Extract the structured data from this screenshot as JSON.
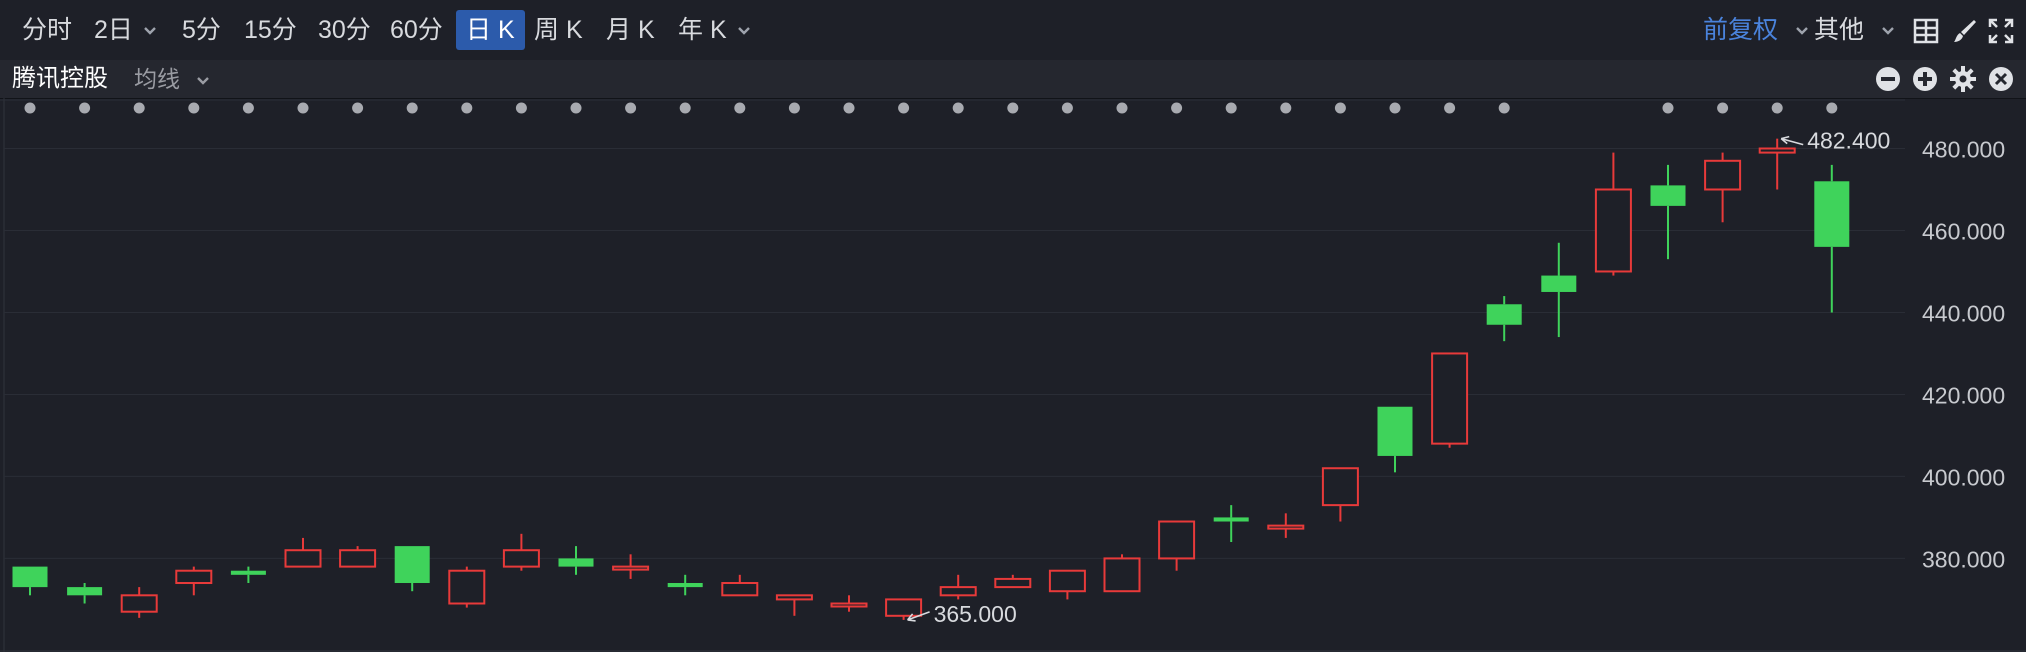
{
  "toolbar": {
    "tabs": [
      {
        "label": "分时"
      },
      {
        "label": "2日"
      },
      {
        "label": "5分"
      },
      {
        "label": "15分"
      },
      {
        "label": "30分"
      },
      {
        "label": "60分"
      },
      {
        "label": "日 K"
      },
      {
        "label": "周 K"
      },
      {
        "label": "月 K"
      },
      {
        "label": "年 K"
      }
    ],
    "active_tab": "日 K",
    "adjust_label": "前复权",
    "other_label": "其他"
  },
  "subbar": {
    "stock_name": "腾讯控股",
    "indicator_label": "均线"
  },
  "colors": {
    "up": "#e83a3a",
    "down": "#3fd35b",
    "accent": "#2c5bab",
    "background": "#1e2028"
  },
  "icons": [
    "grid-layout-icon",
    "brush-icon",
    "fullscreen-icon",
    "minus-icon",
    "plus-icon",
    "gear-icon",
    "close-icon",
    "chevron-down-icon"
  ],
  "chart_data": {
    "type": "candlestick",
    "ylim": [
      364,
      485
    ],
    "yticks": [
      "380.000",
      "400.000",
      "420.000",
      "440.000",
      "460.000",
      "480.000"
    ],
    "grid": true,
    "axis_position": "right",
    "series": [
      {
        "open": 378.0,
        "close": 373.0,
        "high": 378.0,
        "low": 371.0
      },
      {
        "open": 373.0,
        "close": 371.0,
        "high": 374.0,
        "low": 369.0
      },
      {
        "open": 367.0,
        "close": 371.0,
        "high": 373.0,
        "low": 365.5
      },
      {
        "open": 374.0,
        "close": 377.0,
        "high": 378.0,
        "low": 371.0
      },
      {
        "open": 377.0,
        "close": 376.0,
        "high": 378.0,
        "low": 374.0
      },
      {
        "open": 378.0,
        "close": 382.0,
        "high": 385.0,
        "low": 378.0
      },
      {
        "open": 378.0,
        "close": 382.0,
        "high": 383.0,
        "low": 378.0
      },
      {
        "open": 383.0,
        "close": 374.0,
        "high": 383.0,
        "low": 372.0
      },
      {
        "open": 369.0,
        "close": 377.0,
        "high": 378.0,
        "low": 368.0
      },
      {
        "open": 378.0,
        "close": 382.0,
        "high": 386.0,
        "low": 377.0
      },
      {
        "open": 380.0,
        "close": 378.0,
        "high": 383.0,
        "low": 376.0
      },
      {
        "open": 378.0,
        "close": 378.0,
        "high": 381.0,
        "low": 375.0
      },
      {
        "open": 374.0,
        "close": 373.0,
        "high": 376.0,
        "low": 371.0
      },
      {
        "open": 371.0,
        "close": 374.0,
        "high": 376.0,
        "low": 371.0
      },
      {
        "open": 370.0,
        "close": 371.0,
        "high": 371.0,
        "low": 366.0
      },
      {
        "open": 369.0,
        "close": 369.0,
        "high": 371.0,
        "low": 367.0
      },
      {
        "open": 366.0,
        "close": 370.0,
        "high": 370.0,
        "low": 365.0
      },
      {
        "open": 371.0,
        "close": 373.0,
        "high": 376.0,
        "low": 370.0
      },
      {
        "open": 373.0,
        "close": 375.0,
        "high": 376.0,
        "low": 373.0
      },
      {
        "open": 372.0,
        "close": 377.0,
        "high": 377.0,
        "low": 370.0
      },
      {
        "open": 372.0,
        "close": 380.0,
        "high": 381.0,
        "low": 372.0
      },
      {
        "open": 380.0,
        "close": 389.0,
        "high": 389.0,
        "low": 377.0
      },
      {
        "open": 390.0,
        "close": 389.0,
        "high": 393.0,
        "low": 384.0
      },
      {
        "open": 388.0,
        "close": 388.0,
        "high": 391.0,
        "low": 385.0
      },
      {
        "open": 393.0,
        "close": 402.0,
        "high": 402.0,
        "low": 389.0
      },
      {
        "open": 417.0,
        "close": 405.0,
        "high": 417.0,
        "low": 401.0
      },
      {
        "open": 408.0,
        "close": 430.0,
        "high": 430.0,
        "low": 407.0
      },
      {
        "open": 442.0,
        "close": 437.0,
        "high": 444.0,
        "low": 433.0
      },
      {
        "open": 449.0,
        "close": 445.0,
        "high": 457.0,
        "low": 434.0
      },
      {
        "open": 450.0,
        "close": 470.0,
        "high": 479.0,
        "low": 449.0
      },
      {
        "open": 471.0,
        "close": 466.0,
        "high": 476.0,
        "low": 453.0
      },
      {
        "open": 470.0,
        "close": 477.0,
        "high": 479.0,
        "low": 462.0
      },
      {
        "open": 479.0,
        "close": 480.0,
        "high": 482.4,
        "low": 470.0
      },
      {
        "open": 472.0,
        "close": 456.0,
        "high": 476.0,
        "low": 440.0
      }
    ],
    "annotations": [
      {
        "label": "482.400",
        "value": 482.4
      },
      {
        "label": "365.000",
        "value": 365.0
      }
    ]
  }
}
